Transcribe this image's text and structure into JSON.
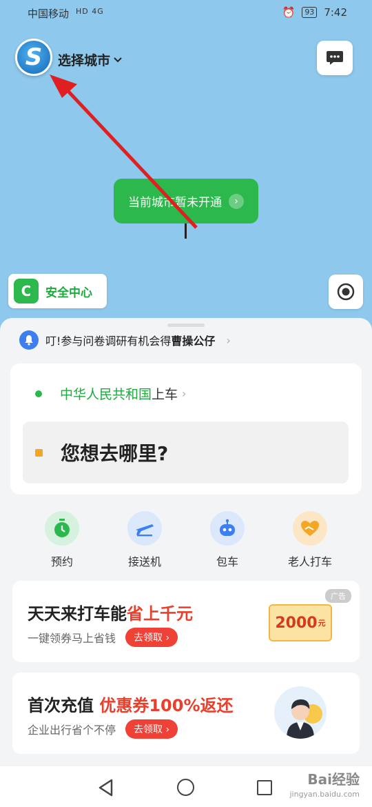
{
  "status_bar": {
    "carrier": "中国移动",
    "network": "HD 4G",
    "battery": "93",
    "time": "7:42"
  },
  "header": {
    "city_select_label": "选择城市"
  },
  "map": {
    "bubble_text": "当前城市暂未开通",
    "safety_center_label": "安全中心"
  },
  "notice": {
    "prefix": "叮!参与问卷调研有机会得",
    "highlight": "曹操公仔"
  },
  "route": {
    "from_place": "中华人民共和国",
    "from_suffix": "上车",
    "to_placeholder": "您想去哪里?"
  },
  "services": [
    {
      "label": "预约",
      "icon": "clock-icon",
      "color": "#2db84d"
    },
    {
      "label": "接送机",
      "icon": "airplane-icon",
      "color": "#3d7ef0"
    },
    {
      "label": "包车",
      "icon": "robot-icon",
      "color": "#3d7ef0"
    },
    {
      "label": "老人打车",
      "icon": "heart-hand-icon",
      "color": "#f5a623"
    }
  ],
  "promos": [
    {
      "title": "天天来打车能",
      "title_highlight": "省上千元",
      "subtitle": "一键领券马上省钱",
      "button": "去领取",
      "ad_tag": "广告",
      "coupon_amount": "2000",
      "coupon_unit": "元"
    },
    {
      "title": "首次充值 ",
      "title_highlight": "优惠券100%返还",
      "subtitle": "企业出行省个不停",
      "button": "去领取"
    }
  ],
  "watermark": {
    "brand": "Bai经验",
    "url": "jingyan.baidu.com"
  },
  "colors": {
    "map_bg": "#8ec8ec",
    "brand_green": "#2db84d",
    "promo_red": "#e8402c",
    "accent_orange": "#f5a623"
  }
}
